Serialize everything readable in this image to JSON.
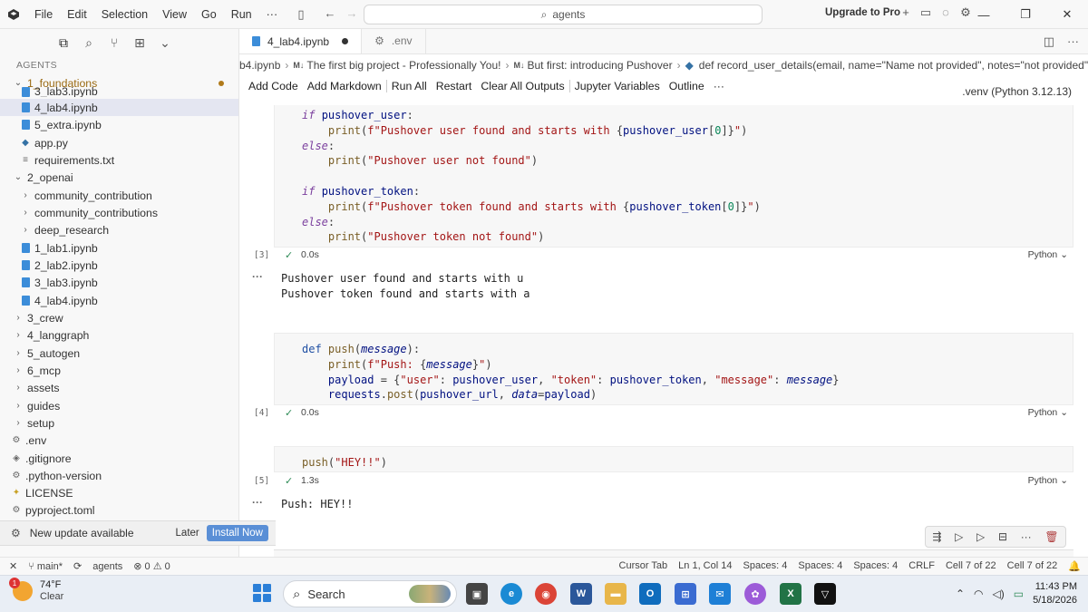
{
  "titlebar": {
    "menu": [
      "File",
      "Edit",
      "Selection",
      "View",
      "Go",
      "Run",
      "···"
    ],
    "search": "agents",
    "upgrade": "Upgrade to Pro"
  },
  "explorer": {
    "header": "AGENTS",
    "rows": [
      {
        "label": "1_foundations",
        "type": "folder-open"
      },
      {
        "label": "3_lab3.ipynb",
        "type": "nb"
      },
      {
        "label": "4_lab4.ipynb",
        "type": "nb"
      },
      {
        "label": "5_extra.ipynb",
        "type": "nb"
      },
      {
        "label": "app.py",
        "type": "py"
      },
      {
        "label": "requirements.txt",
        "type": "txt"
      },
      {
        "label": "2_openai",
        "type": "folder-open"
      },
      {
        "label": "community_contribution",
        "type": "folder"
      },
      {
        "label": "community_contributions",
        "type": "folder"
      },
      {
        "label": "deep_research",
        "type": "folder"
      },
      {
        "label": "1_lab1.ipynb",
        "type": "nb"
      },
      {
        "label": "2_lab2.ipynb",
        "type": "nb"
      },
      {
        "label": "3_lab3.ipynb",
        "type": "nb"
      },
      {
        "label": "4_lab4.ipynb",
        "type": "nb"
      },
      {
        "label": "3_crew",
        "type": "folder"
      },
      {
        "label": "4_langgraph",
        "type": "folder"
      },
      {
        "label": "5_autogen",
        "type": "folder"
      },
      {
        "label": "6_mcp",
        "type": "folder"
      },
      {
        "label": "assets",
        "type": "folder"
      },
      {
        "label": "guides",
        "type": "folder"
      },
      {
        "label": "setup",
        "type": "folder"
      },
      {
        "label": ".env",
        "type": "gear"
      },
      {
        "label": ".gitignore",
        "type": "git"
      },
      {
        "label": ".python-version",
        "type": "gear"
      },
      {
        "label": "LICENSE",
        "type": "license"
      },
      {
        "label": "pyproject.toml",
        "type": "gear"
      }
    ],
    "modified_marker": "M"
  },
  "update_toast": {
    "message": "New update available",
    "later": "Later",
    "install": "Install Now"
  },
  "tabs": [
    {
      "label": "4_lab4.ipynb",
      "active": true
    },
    {
      "label": ".env",
      "active": false
    }
  ],
  "breadcrumb": {
    "file": "b4.ipynb",
    "md1": "M↓",
    "section1": "The first big project - Professionally You!",
    "md2": "M↓",
    "section2": "But first: introducing Pushover",
    "func": "def record_user_details(email, name=\"Name not provided\", notes=\"not provided\"):"
  },
  "nb_toolbar": {
    "add_code": "Add Code",
    "add_markdown": "Add Markdown",
    "run_all": "Run All",
    "restart": "Restart",
    "clear_outputs": "Clear All Outputs",
    "jupyter_variables": "Jupyter Variables",
    "outline": "Outline",
    "more": "···",
    "kernel": ".venv (Python 3.12.13)"
  },
  "cells": [
    {
      "exec": "[3]",
      "time": "0.0s",
      "lang": "Python"
    },
    {
      "exec": "[4]",
      "time": "0.0s",
      "lang": "Python"
    },
    {
      "exec": "[5]",
      "time": "1.3s",
      "lang": "Python"
    }
  ],
  "outputs": {
    "out3_line1": "Pushover user found and starts with u",
    "out3_line2": "Pushover token found and starts with a",
    "out5_line1": "Push: HEY!!",
    "dots": "···"
  },
  "statusbar": {
    "branch": "main*",
    "workspace": "agents",
    "problems": "0",
    "warnings": "0",
    "cursor_tab": "Cursor Tab",
    "position": "Ln 1, Col 14",
    "spaces1": "Spaces: 4",
    "spaces2": "Spaces: 4",
    "spaces3": "Spaces: 4",
    "eol": "CRLF",
    "cell1": "Cell 7 of 22",
    "cell2": "Cell 7 of 22"
  },
  "taskbar": {
    "temp": "74°F",
    "weather": "Clear",
    "weather_badge": "1",
    "search": "Search",
    "time": "11:43 PM",
    "date": "5/18/2026"
  }
}
